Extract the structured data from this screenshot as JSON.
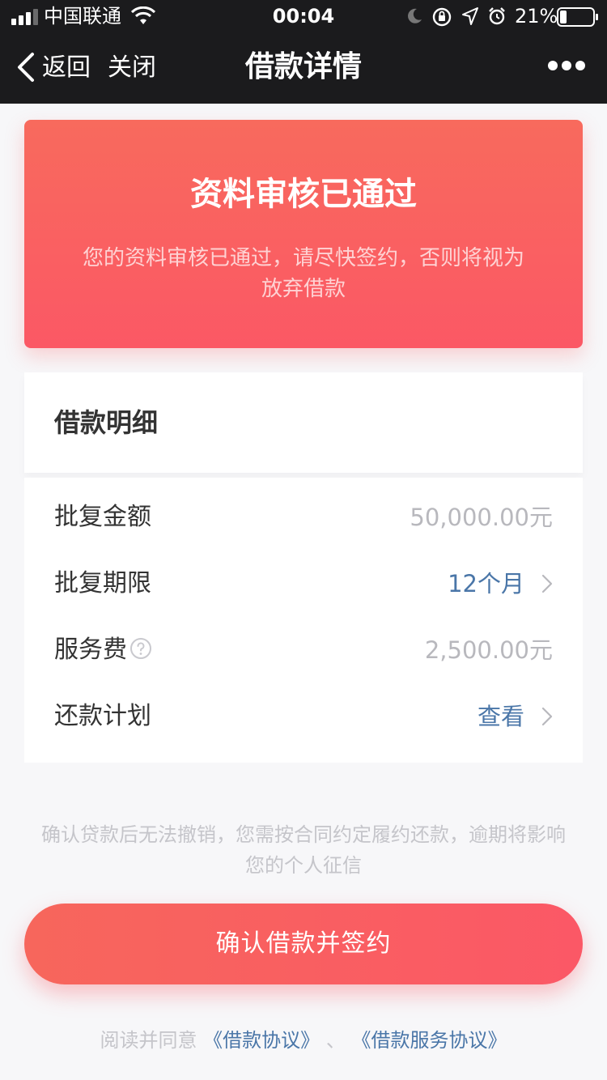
{
  "status_bar": {
    "carrier": "中国联通",
    "time": "00:04",
    "battery_percent": "21%",
    "battery_level": 0.21,
    "icons": [
      "signal-icon",
      "wifi-icon",
      "moon-icon",
      "rotation-lock-icon",
      "location-icon",
      "alarm-icon",
      "battery-icon"
    ]
  },
  "nav": {
    "back_label": "返回",
    "close_label": "关闭",
    "title": "借款详情",
    "more_icon": "more-icon"
  },
  "banner": {
    "title": "资料审核已通过",
    "description": "您的资料审核已通过，请尽快签约，否则将视为放弃借款"
  },
  "details": {
    "title": "借款明细",
    "rows": [
      {
        "label": "批复金额",
        "value": "50,000.00元"
      },
      {
        "label": "批复期限",
        "value": "12个月"
      },
      {
        "label": "服务费",
        "value": "2,500.00元"
      },
      {
        "label": "还款计划",
        "value": "查看"
      }
    ]
  },
  "notice": "确认贷款后无法撤销，您需按合同约定履约还款，逾期将影响您的个人征信",
  "confirm_button": "确认借款并签约",
  "agreement": {
    "prefix": "阅读并同意",
    "loan_agreement": "《借款协议》",
    "separator": "、",
    "service_agreement": "《借款服务协议》"
  },
  "colors": {
    "accent": "#fb5865",
    "link": "#4a76a8",
    "topbar": "#1b1b1d"
  }
}
